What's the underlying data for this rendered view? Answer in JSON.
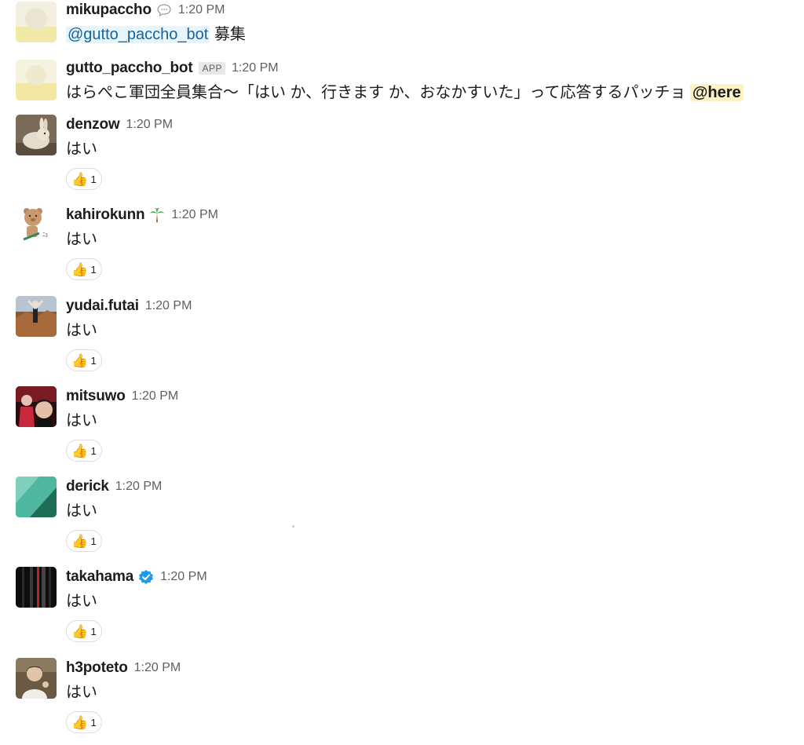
{
  "messages": [
    {
      "username": "mikupaccho",
      "status_icon": "speech-bubble-icon",
      "time": "1:20 PM",
      "mention": "@gutto_paccho_bot",
      "text": " 募集"
    },
    {
      "username": "gutto_paccho_bot",
      "badge": "APP",
      "time": "1:20 PM",
      "text": "はらぺこ軍団全員集合〜「はい か、行きます か、おなかすいた」って応答するパッチョ",
      "here": "@here"
    },
    {
      "username": "denzow",
      "time": "1:20 PM",
      "text": "はい",
      "reaction": {
        "emoji": "👍",
        "count": "1",
        "icon": "thumbs-up-icon"
      }
    },
    {
      "username": "kahirokunn",
      "status_icon": "palm-tree-icon",
      "time": "1:20 PM",
      "text": "はい",
      "reaction": {
        "emoji": "👍",
        "count": "1",
        "icon": "thumbs-up-icon"
      }
    },
    {
      "username": "yudai.futai",
      "time": "1:20 PM",
      "text": "はい",
      "reaction": {
        "emoji": "👍",
        "count": "1",
        "icon": "thumbs-up-icon"
      }
    },
    {
      "username": "mitsuwo",
      "time": "1:20 PM",
      "text": "はい",
      "reaction": {
        "emoji": "👍",
        "count": "1",
        "icon": "thumbs-up-icon"
      }
    },
    {
      "username": "derick",
      "time": "1:20 PM",
      "text": "はい",
      "reaction": {
        "emoji": "👍",
        "count": "1",
        "icon": "thumbs-up-icon"
      }
    },
    {
      "username": "takahama",
      "status_icon": "verified-badge-icon",
      "time": "1:20 PM",
      "text": "はい",
      "reaction": {
        "emoji": "👍",
        "count": "1",
        "icon": "thumbs-up-icon"
      }
    },
    {
      "username": "h3poteto",
      "time": "1:20 PM",
      "text": "はい",
      "reaction": {
        "emoji": "👍",
        "count": "1",
        "icon": "thumbs-up-icon"
      }
    }
  ],
  "colors": {
    "mention_text": "#1264a3",
    "here_highlight": "#fdf1c6",
    "timestamp": "#616061",
    "verified_badge": "#1d9bf0"
  }
}
